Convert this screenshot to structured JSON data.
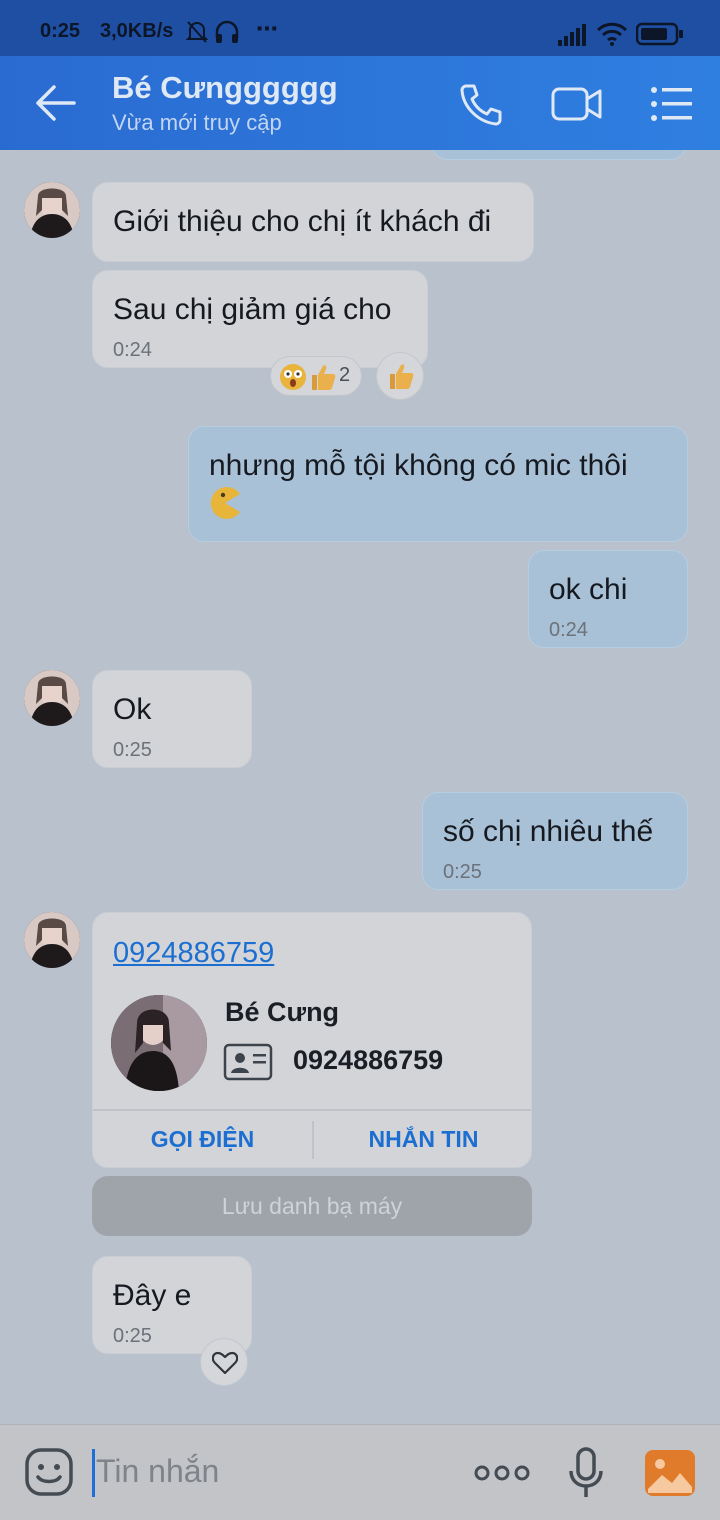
{
  "status_bar": {
    "time": "0:25",
    "net_speed": "3,0KB/s",
    "more": "⋯"
  },
  "header": {
    "title": "Bé Cưngggggg",
    "subtitle": "Vừa mới truy cập"
  },
  "messages": [
    {
      "text": "Giới thiệu cho chị ít khách đi",
      "time": ""
    },
    {
      "text": "Sau chị giảm giá cho",
      "time": "0:24"
    },
    {
      "text": "nhưng mỗ tội không có mic thôi",
      "time": ""
    },
    {
      "text": "ok chi",
      "time": "0:24"
    },
    {
      "text": "Ok",
      "time": "0:25"
    },
    {
      "text": "số chị nhiêu thế",
      "time": "0:25"
    },
    {
      "text": "Đây e",
      "time": "0:25"
    }
  ],
  "reactions": {
    "count": "2"
  },
  "contact_card": {
    "phone_link": "0924886759",
    "name": "Bé Cưng",
    "phone": "0924886759",
    "call_label": "GỌI ĐIỆN",
    "message_label": "NHẮN TIN",
    "save_label": "Lưu danh bạ máy"
  },
  "input": {
    "placeholder": "Tin nhắn"
  },
  "colors": {
    "header": "#2a6bd1",
    "outgoing_bubble": "#a9c1d6",
    "incoming_bubble": "#d2d4d8",
    "link": "#1c6fd1"
  }
}
